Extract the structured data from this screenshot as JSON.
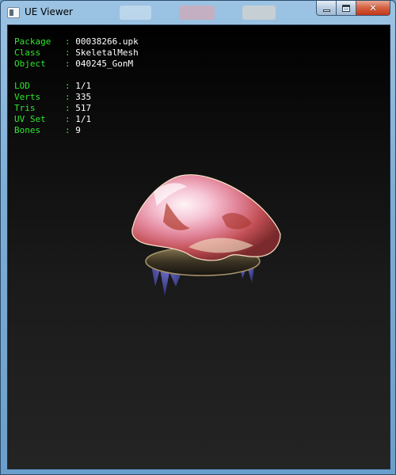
{
  "window": {
    "title": "UE Viewer",
    "icon": "app-window-icon",
    "buttons": {
      "minimize": "minimize-icon",
      "maximize": "maximize-icon",
      "close": "close-icon"
    }
  },
  "info": {
    "package": {
      "label": "Package",
      "value": "00038266.upk"
    },
    "class": {
      "label": "Class",
      "value": "SkeletalMesh"
    },
    "object": {
      "label": "Object",
      "value": "040245_GonM"
    },
    "lod": {
      "label": "LOD",
      "value": "1/1"
    },
    "verts": {
      "label": "Verts",
      "value": "335"
    },
    "tris": {
      "label": "Tris",
      "value": "517"
    },
    "uvset": {
      "label": "UV Set",
      "value": "1/1"
    },
    "bones": {
      "label": "Bones",
      "value": "9"
    }
  },
  "colors": {
    "label_green": "#2ee62e",
    "value_white": "#ffffff",
    "viewport_bg_top": "#000000",
    "viewport_bg_bottom": "#242424"
  }
}
